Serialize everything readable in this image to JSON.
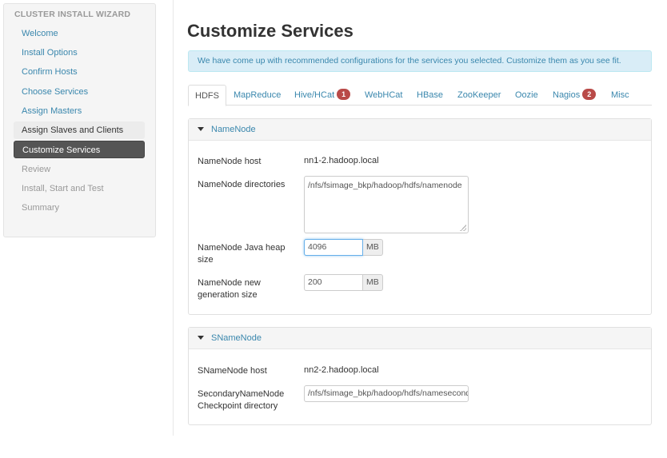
{
  "sidebar": {
    "header": "CLUSTER INSTALL WIZARD",
    "items": [
      {
        "label": "Welcome",
        "state": "link"
      },
      {
        "label": "Install Options",
        "state": "link"
      },
      {
        "label": "Confirm Hosts",
        "state": "link"
      },
      {
        "label": "Choose Services",
        "state": "link"
      },
      {
        "label": "Assign Masters",
        "state": "link"
      },
      {
        "label": "Assign Slaves and Clients",
        "state": "visited"
      },
      {
        "label": "Customize Services",
        "state": "active"
      },
      {
        "label": "Review",
        "state": "disabled"
      },
      {
        "label": "Install, Start and Test",
        "state": "disabled"
      },
      {
        "label": "Summary",
        "state": "disabled"
      }
    ]
  },
  "main": {
    "title": "Customize Services",
    "alert": "We have come up with recommended configurations for the services you selected. Customize them as you see fit.",
    "tabs": [
      {
        "label": "HDFS",
        "active": true
      },
      {
        "label": "MapReduce"
      },
      {
        "label": "Hive/HCat",
        "badge": "1"
      },
      {
        "label": "WebHCat"
      },
      {
        "label": "HBase"
      },
      {
        "label": "ZooKeeper"
      },
      {
        "label": "Oozie"
      },
      {
        "label": "Nagios",
        "badge": "2"
      },
      {
        "label": "Misc"
      }
    ],
    "namenode": {
      "heading": "NameNode",
      "host_label": "NameNode host",
      "host_value": "nn1-2.hadoop.local",
      "dirs_label": "NameNode directories",
      "dirs_value": "/nfs/fsimage_bkp/hadoop/hdfs/namenode",
      "heap_label": "NameNode Java heap size",
      "heap_value": "4096",
      "heap_unit": "MB",
      "newgen_label": "NameNode new generation size",
      "newgen_value": "200",
      "newgen_unit": "MB"
    },
    "snamenode": {
      "heading": "SNameNode",
      "host_label": "SNameNode host",
      "host_value": "nn2-2.hadoop.local",
      "checkpoint_label": "SecondaryNameNode Checkpoint directory",
      "checkpoint_value": "/nfs/fsimage_bkp/hadoop/hdfs/namesecondary"
    }
  },
  "colors": {
    "link": "#3a87ad",
    "active_nav": "#555555",
    "alert_bg": "#d9edf7",
    "badge": "#b94a48"
  }
}
